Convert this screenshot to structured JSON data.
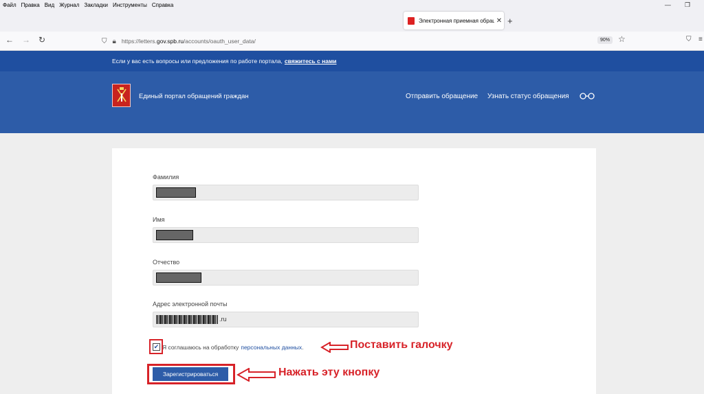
{
  "menubar": {
    "items": [
      "Файл",
      "Правка",
      "Вид",
      "Журнал",
      "Закладки",
      "Инструменты",
      "Справка"
    ]
  },
  "window_controls": {
    "minimize": "—",
    "restore": "❐"
  },
  "tab": {
    "title": "Электронная приемная обращ",
    "close": "✕",
    "new_tab": "+"
  },
  "navbar": {
    "back": "←",
    "forward": "→",
    "reload": "↻",
    "url_prefix": "https://letters.",
    "url_domain": "gov.spb.ru",
    "url_path": "/accounts/oauth_user_data/",
    "zoom": "90%",
    "star": "☆"
  },
  "info_bar": {
    "text": "Если у вас есть вопросы или предложения по работе портала,",
    "link": "свяжитесь с нами"
  },
  "header": {
    "portal_title": "Единый портал обращений граждан",
    "nav_send": "Отправить обращение",
    "nav_status": "Узнать статус обращения",
    "accessibility_icon": "∞"
  },
  "form": {
    "surname_label": "Фамилия",
    "name_label": "Имя",
    "patronymic_label": "Отчество",
    "email_label": "Адрес электронной почты",
    "email_suffix": ".ru",
    "agree_text": "Я соглашаюсь на обработку",
    "agree_link": "персональных данных",
    "agree_checked": true,
    "submit": "Зарегистрироваться"
  },
  "annotations": {
    "check_hint": "Поставить галочку",
    "button_hint": "Нажать эту кнопку"
  },
  "colors": {
    "brand_blue": "#2d5ca8",
    "info_blue": "#1f4fa0",
    "annotation_red": "#d72228"
  }
}
